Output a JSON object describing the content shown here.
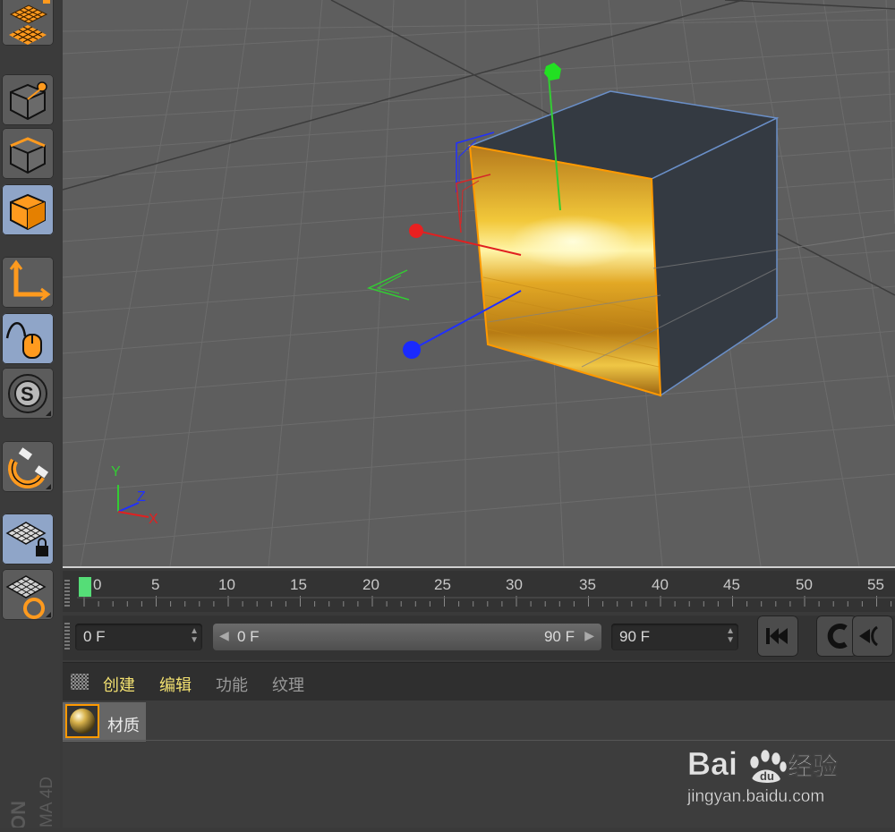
{
  "app": {
    "brand_top": "ON",
    "brand_bottom": "MA 4D"
  },
  "sidebar": {
    "tools": [
      {
        "name": "workplane",
        "active": false
      },
      {
        "name": "points-mode",
        "active": false
      },
      {
        "name": "edges-mode",
        "active": false
      },
      {
        "name": "polygons-mode",
        "active": true
      },
      {
        "name": "axis-mode",
        "active": false
      },
      {
        "name": "tweak-mode",
        "active": true
      },
      {
        "name": "solo",
        "active": false
      },
      {
        "name": "snap",
        "active": false
      },
      {
        "name": "workplane-lock",
        "active": true
      },
      {
        "name": "workplane-align",
        "active": false
      }
    ]
  },
  "viewport": {
    "axis_labels": {
      "y": "Y",
      "z": "Z",
      "x": "X"
    },
    "colors": {
      "y": "#33cc33",
      "x": "#e02020",
      "z": "#2030ff",
      "selection": "#ff9900"
    }
  },
  "timeline": {
    "ticks": [
      "0",
      "5",
      "10",
      "15",
      "20",
      "25",
      "30",
      "35",
      "40",
      "45",
      "50",
      "55"
    ],
    "current_frame": "0",
    "playhead_color": "#55dd77"
  },
  "controls": {
    "start_frame": "0 F",
    "range_start": "0 F",
    "range_end": "90 F",
    "end_frame": "90 F",
    "buttons": [
      "go-to-start",
      "play-reverse",
      "step-back"
    ]
  },
  "material_manager": {
    "menu": [
      {
        "label": "创建",
        "highlight": true
      },
      {
        "label": "编辑",
        "highlight": true
      },
      {
        "label": "功能",
        "highlight": false
      },
      {
        "label": "纹理",
        "highlight": false
      }
    ],
    "materials": [
      {
        "name": "材质"
      }
    ]
  },
  "watermark": {
    "brand": "Bai",
    "brand_suffix": "经验",
    "url": "jingyan.baidu.com"
  }
}
